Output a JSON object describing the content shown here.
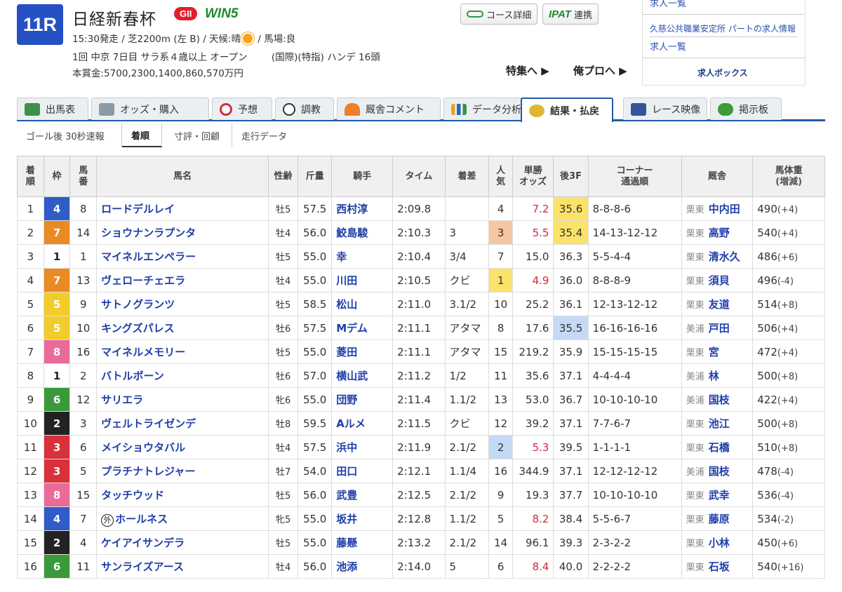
{
  "race": {
    "number": "11R",
    "name": "日経新春杯",
    "grade": "GII",
    "win5": "WIN5",
    "line1a": "15:30発走 / 芝2200m (左 B) / 天候:晴",
    "line1b": " / 馬場:良",
    "line2": "1回 中京 7日目 サラ系４歳以上 オープン        (国際)(特指) ハンデ 16頭",
    "line3": "本賞金:5700,2300,1400,860,570万円"
  },
  "buttons": {
    "course": "コース詳細",
    "ipat_logo": "IPAT",
    "ipat_label": "連携"
  },
  "links": {
    "feature": "特集へ ▶",
    "pro": "俺プロへ ▶"
  },
  "ad": {
    "top": "求人一覧",
    "title": "久慈公共職業安定所 パートの求人情報",
    "list": "求人一覧",
    "logo": "求人ボックス"
  },
  "tabs": [
    "出馬表",
    "オッズ・購入",
    "予想",
    "調教",
    "厩舎コメント",
    "データ分析",
    "結果・払戻",
    "レース映像",
    "掲示板"
  ],
  "subtabs": [
    "ゴール後 30秒速報",
    "着順",
    "寸評・回顧",
    "走行データ"
  ],
  "headers": {
    "rank": [
      "着",
      "順"
    ],
    "waku": "枠",
    "num": [
      "馬",
      "番"
    ],
    "name": "馬名",
    "sex": "性齢",
    "kin": "斤量",
    "jockey": "騎手",
    "time": "タイム",
    "margin": "着差",
    "pop": [
      "人",
      "気"
    ],
    "odds": [
      "単勝",
      "オッズ"
    ],
    "f3": "後3F",
    "corner": [
      "コーナー",
      "通過順"
    ],
    "stable": "厩舎",
    "weight": [
      "馬体重",
      "(増減)"
    ]
  },
  "colors": {
    "waku": {
      "1": "#ffffff",
      "2": "#222222",
      "3": "#d9303a",
      "4": "#2f5cc8",
      "5": "#f2cc2b",
      "6": "#3a9a3a",
      "7": "#e98a24",
      "8": "#ea6a9a"
    },
    "pop1": "#fbe26a",
    "pop2": "#c4d9f6",
    "pop3": "#f6c6a0",
    "f3_1": "#fbe26a",
    "f3_2": "#fbe26a",
    "f3_3": "#c4d9f6"
  },
  "rows": [
    {
      "rank": "1",
      "waku": "4",
      "num": "8",
      "name": "ロードデルレイ",
      "sex": "牡5",
      "kin": "57.5",
      "jockey": "西村淳",
      "time": "2:09.8",
      "margin": "",
      "pop": "4",
      "odds": "7.2",
      "f3": "35.6",
      "corner": "8-8-8-6",
      "region": "栗東",
      "trainer": "中内田",
      "weight": "490",
      "diff": "(+4)"
    },
    {
      "rank": "2",
      "waku": "7",
      "num": "14",
      "name": "ショウナンラプンタ",
      "sex": "牡4",
      "kin": "56.0",
      "jockey": "鮫島駿",
      "time": "2:10.3",
      "margin": "3",
      "pop": "3",
      "odds": "5.5",
      "f3": "35.4",
      "corner": "14-13-12-12",
      "region": "栗東",
      "trainer": "高野",
      "weight": "540",
      "diff": "(+4)"
    },
    {
      "rank": "3",
      "waku": "1",
      "num": "1",
      "name": "マイネルエンペラー",
      "sex": "牡5",
      "kin": "55.0",
      "jockey": "幸",
      "time": "2:10.4",
      "margin": "3/4",
      "pop": "7",
      "odds": "15.0",
      "f3": "36.3",
      "corner": "5-5-4-4",
      "region": "栗東",
      "trainer": "清水久",
      "weight": "486",
      "diff": "(+6)"
    },
    {
      "rank": "4",
      "waku": "7",
      "num": "13",
      "name": "ヴェローチェエラ",
      "sex": "牡4",
      "kin": "55.0",
      "jockey": "川田",
      "time": "2:10.5",
      "margin": "クビ",
      "pop": "1",
      "odds": "4.9",
      "f3": "36.0",
      "corner": "8-8-8-9",
      "region": "栗東",
      "trainer": "須貝",
      "weight": "496",
      "diff": "(-4)"
    },
    {
      "rank": "5",
      "waku": "5",
      "num": "9",
      "name": "サトノグランツ",
      "sex": "牡5",
      "kin": "58.5",
      "jockey": "松山",
      "time": "2:11.0",
      "margin": "3.1/2",
      "pop": "10",
      "odds": "25.2",
      "f3": "36.1",
      "corner": "12-13-12-12",
      "region": "栗東",
      "trainer": "友道",
      "weight": "514",
      "diff": "(+8)"
    },
    {
      "rank": "6",
      "waku": "5",
      "num": "10",
      "name": "キングズパレス",
      "sex": "牡6",
      "kin": "57.5",
      "jockey": "Mデム",
      "time": "2:11.1",
      "margin": "アタマ",
      "pop": "8",
      "odds": "17.6",
      "f3": "35.5",
      "corner": "16-16-16-16",
      "region": "美浦",
      "trainer": "戸田",
      "weight": "506",
      "diff": "(+4)"
    },
    {
      "rank": "7",
      "waku": "8",
      "num": "16",
      "name": "マイネルメモリー",
      "sex": "牡5",
      "kin": "55.0",
      "jockey": "菱田",
      "time": "2:11.1",
      "margin": "アタマ",
      "pop": "15",
      "odds": "219.2",
      "f3": "35.9",
      "corner": "15-15-15-15",
      "region": "栗東",
      "trainer": "宮",
      "weight": "472",
      "diff": "(+4)"
    },
    {
      "rank": "8",
      "waku": "1",
      "num": "2",
      "name": "バトルボーン",
      "sex": "牡6",
      "kin": "57.0",
      "jockey": "横山武",
      "time": "2:11.2",
      "margin": "1/2",
      "pop": "11",
      "odds": "35.6",
      "f3": "37.1",
      "corner": "4-4-4-4",
      "region": "美浦",
      "trainer": "林",
      "weight": "500",
      "diff": "(+8)"
    },
    {
      "rank": "9",
      "waku": "6",
      "num": "12",
      "name": "サリエラ",
      "sex": "牝6",
      "kin": "55.0",
      "jockey": "団野",
      "time": "2:11.4",
      "margin": "1.1/2",
      "pop": "13",
      "odds": "53.0",
      "f3": "36.7",
      "corner": "10-10-10-10",
      "region": "美浦",
      "trainer": "国枝",
      "weight": "422",
      "diff": "(+4)"
    },
    {
      "rank": "10",
      "waku": "2",
      "num": "3",
      "name": "ヴェルトライゼンデ",
      "sex": "牡8",
      "kin": "59.5",
      "jockey": "Aルメ",
      "time": "2:11.5",
      "margin": "クビ",
      "pop": "12",
      "odds": "39.2",
      "f3": "37.1",
      "corner": "7-7-6-7",
      "region": "栗東",
      "trainer": "池江",
      "weight": "500",
      "diff": "(+8)"
    },
    {
      "rank": "11",
      "waku": "3",
      "num": "6",
      "name": "メイショウタバル",
      "sex": "牡4",
      "kin": "57.5",
      "jockey": "浜中",
      "time": "2:11.9",
      "margin": "2.1/2",
      "pop": "2",
      "odds": "5.3",
      "f3": "39.5",
      "corner": "1-1-1-1",
      "region": "栗東",
      "trainer": "石橋",
      "weight": "510",
      "diff": "(+8)"
    },
    {
      "rank": "12",
      "waku": "3",
      "num": "5",
      "name": "プラチナトレジャー",
      "sex": "牡7",
      "kin": "54.0",
      "jockey": "田口",
      "time": "2:12.1",
      "margin": "1.1/4",
      "pop": "16",
      "odds": "344.9",
      "f3": "37.1",
      "corner": "12-12-12-12",
      "region": "美浦",
      "trainer": "国枝",
      "weight": "478",
      "diff": "(-4)"
    },
    {
      "rank": "13",
      "waku": "8",
      "num": "15",
      "name": "タッチウッド",
      "sex": "牡5",
      "kin": "56.0",
      "jockey": "武豊",
      "time": "2:12.5",
      "margin": "2.1/2",
      "pop": "9",
      "odds": "19.3",
      "f3": "37.7",
      "corner": "10-10-10-10",
      "region": "栗東",
      "trainer": "武幸",
      "weight": "536",
      "diff": "(-4)"
    },
    {
      "rank": "14",
      "waku": "4",
      "num": "7",
      "name": "ホールネス",
      "foreign": "外",
      "sex": "牝5",
      "kin": "55.0",
      "jockey": "坂井",
      "time": "2:12.8",
      "margin": "1.1/2",
      "pop": "5",
      "odds": "8.2",
      "f3": "38.4",
      "corner": "5-5-6-7",
      "region": "栗東",
      "trainer": "藤原",
      "weight": "534",
      "diff": "(-2)"
    },
    {
      "rank": "15",
      "waku": "2",
      "num": "4",
      "name": "ケイアイサンデラ",
      "sex": "牡5",
      "kin": "55.0",
      "jockey": "藤懸",
      "time": "2:13.2",
      "margin": "2.1/2",
      "pop": "14",
      "odds": "96.1",
      "f3": "39.3",
      "corner": "2-3-2-2",
      "region": "栗東",
      "trainer": "小林",
      "weight": "450",
      "diff": "(+6)"
    },
    {
      "rank": "16",
      "waku": "6",
      "num": "11",
      "name": "サンライズアース",
      "sex": "牡4",
      "kin": "56.0",
      "jockey": "池添",
      "time": "2:14.0",
      "margin": "5",
      "pop": "6",
      "odds": "8.4",
      "f3": "40.0",
      "corner": "2-2-2-2",
      "region": "栗東",
      "trainer": "石坂",
      "weight": "540",
      "diff": "(+16)"
    }
  ]
}
